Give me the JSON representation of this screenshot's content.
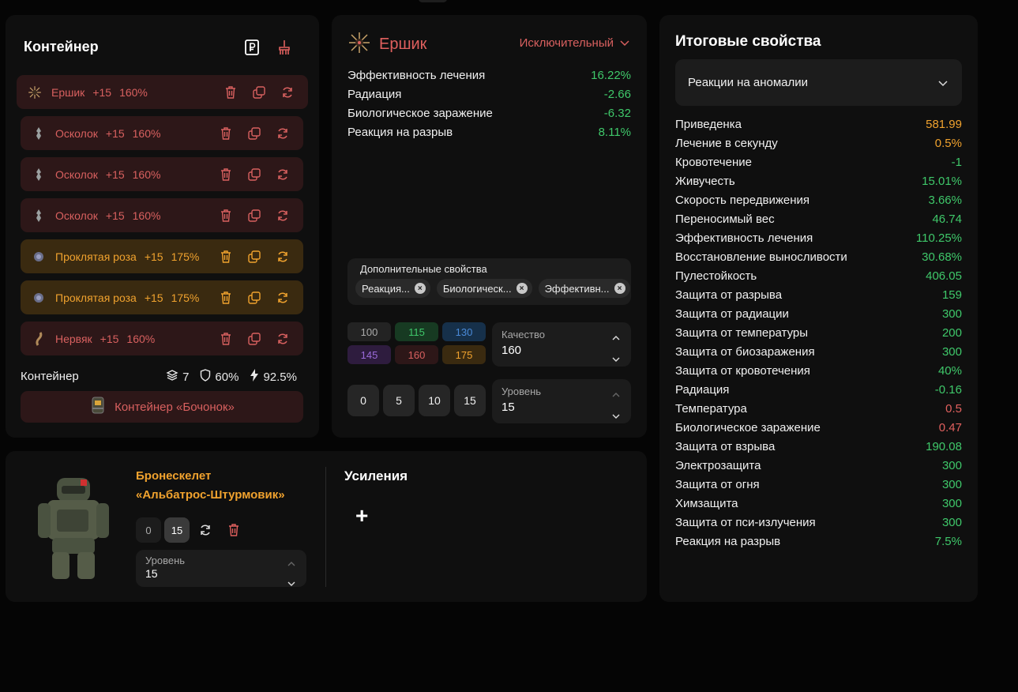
{
  "container": {
    "title": "Контейнер",
    "artifacts": [
      {
        "name": "Ершик",
        "level": "+15",
        "percent": "160%",
        "tone": "red"
      },
      {
        "name": "Осколок",
        "level": "+15",
        "percent": "160%",
        "tone": "red"
      },
      {
        "name": "Осколок",
        "level": "+15",
        "percent": "160%",
        "tone": "red"
      },
      {
        "name": "Осколок",
        "level": "+15",
        "percent": "160%",
        "tone": "red"
      },
      {
        "name": "Проклятая роза",
        "level": "+15",
        "percent": "175%",
        "tone": "gold"
      },
      {
        "name": "Проклятая роза",
        "level": "+15",
        "percent": "175%",
        "tone": "gold"
      },
      {
        "name": "Нервяк",
        "level": "+15",
        "percent": "160%",
        "tone": "red"
      }
    ],
    "footer_label": "Контейнер",
    "slots": "7",
    "protection": "60%",
    "efficiency": "92.5%",
    "container_button": "Контейнер «Бочонок»"
  },
  "item": {
    "title": "Ершик",
    "rarity": "Исключительный",
    "stats": [
      {
        "name": "Эффективность лечения",
        "value": "16.22%"
      },
      {
        "name": "Радиация",
        "value": "-2.66"
      },
      {
        "name": "Биологическое заражение",
        "value": "-6.32"
      },
      {
        "name": "Реакция на разрыв",
        "value": "8.11%"
      }
    ],
    "additional_title": "Дополнительные свойства",
    "chips": [
      "Реакция...",
      "Биологическ...",
      "Эффективн..."
    ],
    "quality_options": [
      "100",
      "115",
      "130",
      "145",
      "160",
      "175"
    ],
    "quality_label": "Качество",
    "quality_value": "160",
    "level_options": [
      "0",
      "5",
      "10",
      "15"
    ],
    "level_label": "Уровень",
    "level_value": "15"
  },
  "props": {
    "title": "Итоговые свойства",
    "filter": "Реакции на аномалии",
    "rows": [
      {
        "name": "Приведенка",
        "value": "581.99",
        "color": "orange"
      },
      {
        "name": "Лечение в секунду",
        "value": "0.5%",
        "color": "orange"
      },
      {
        "name": "Кровотечение",
        "value": "-1",
        "color": "green"
      },
      {
        "name": "Живучесть",
        "value": "15.01%",
        "color": "green"
      },
      {
        "name": "Скорость передвижения",
        "value": "3.66%",
        "color": "green"
      },
      {
        "name": "Переносимый вес",
        "value": "46.74",
        "color": "green"
      },
      {
        "name": "Эффективность лечения",
        "value": "110.25%",
        "color": "green"
      },
      {
        "name": "Восстановление выносливости",
        "value": "30.68%",
        "color": "green"
      },
      {
        "name": "Пулестойкость",
        "value": "406.05",
        "color": "green"
      },
      {
        "name": "Защита от разрыва",
        "value": "159",
        "color": "green"
      },
      {
        "name": "Защита от радиации",
        "value": "300",
        "color": "green"
      },
      {
        "name": "Защита от температуры",
        "value": "200",
        "color": "green"
      },
      {
        "name": "Защита от биозаражения",
        "value": "300",
        "color": "green"
      },
      {
        "name": "Защита от кровотечения",
        "value": "40%",
        "color": "green"
      },
      {
        "name": "Радиация",
        "value": "-0.16",
        "color": "green"
      },
      {
        "name": "Температура",
        "value": "0.5",
        "color": "red"
      },
      {
        "name": "Биологическое заражение",
        "value": "0.47",
        "color": "red"
      },
      {
        "name": "Защита от взрыва",
        "value": "190.08",
        "color": "green"
      },
      {
        "name": "Электрозащита",
        "value": "300",
        "color": "green"
      },
      {
        "name": "Защита от огня",
        "value": "300",
        "color": "green"
      },
      {
        "name": "Химзащита",
        "value": "300",
        "color": "green"
      },
      {
        "name": "Защита от пси-излучения",
        "value": "300",
        "color": "green"
      },
      {
        "name": "Реакция на разрыв",
        "value": "7.5%",
        "color": "green"
      }
    ]
  },
  "armor": {
    "name_line1": "Бронескелет",
    "name_line2": "«Альбатрос-Штурмовик»",
    "level_options": [
      "0",
      "15"
    ],
    "level_label": "Уровень",
    "level_value": "15",
    "boosts_title": "Усиления",
    "add_symbol": "+"
  },
  "colors": {
    "red_text": "#d8605f",
    "gold_text": "#f0a22e",
    "green": "#3fc86a",
    "red_bg": "#2d1718",
    "gold_bg": "#3a2a10"
  },
  "icons": {
    "row_actions": [
      "trash-icon",
      "copy-icon",
      "refresh-icon"
    ],
    "header": [
      "ruble-icon",
      "broom-icon"
    ]
  }
}
